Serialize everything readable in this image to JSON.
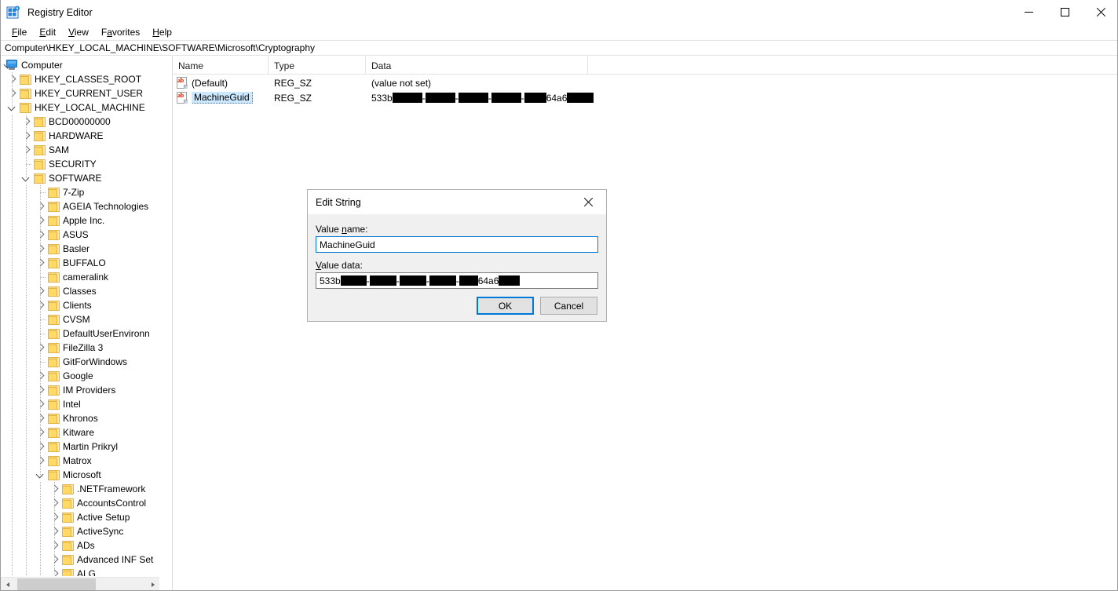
{
  "window": {
    "title": "Registry Editor",
    "icon": "registry-editor-icon",
    "controls": {
      "minimize": "minimize",
      "maximize": "maximize",
      "close": "close"
    }
  },
  "menubar": {
    "items": [
      {
        "label": "File",
        "mnemonic": "F"
      },
      {
        "label": "Edit",
        "mnemonic": "E"
      },
      {
        "label": "View",
        "mnemonic": "V"
      },
      {
        "label": "Favorites",
        "mnemonic": "a"
      },
      {
        "label": "Help",
        "mnemonic": "H"
      }
    ]
  },
  "address": {
    "path": "Computer\\HKEY_LOCAL_MACHINE\\SOFTWARE\\Microsoft\\Cryptography"
  },
  "tree": {
    "items": [
      {
        "label": "Computer",
        "depth": 0,
        "state": "expanded",
        "icon": "computer-icon"
      },
      {
        "label": "HKEY_CLASSES_ROOT",
        "depth": 1,
        "state": "collapsed",
        "icon": "folder-icon"
      },
      {
        "label": "HKEY_CURRENT_USER",
        "depth": 1,
        "state": "collapsed",
        "icon": "folder-icon"
      },
      {
        "label": "HKEY_LOCAL_MACHINE",
        "depth": 1,
        "state": "expanded",
        "icon": "folder-icon"
      },
      {
        "label": "BCD00000000",
        "depth": 2,
        "state": "collapsed",
        "icon": "folder-icon"
      },
      {
        "label": "HARDWARE",
        "depth": 2,
        "state": "collapsed",
        "icon": "folder-icon"
      },
      {
        "label": "SAM",
        "depth": 2,
        "state": "collapsed",
        "icon": "folder-icon"
      },
      {
        "label": "SECURITY",
        "depth": 2,
        "state": "leaf",
        "icon": "folder-icon"
      },
      {
        "label": "SOFTWARE",
        "depth": 2,
        "state": "expanded",
        "icon": "folder-icon"
      },
      {
        "label": "7-Zip",
        "depth": 3,
        "state": "leaf",
        "icon": "folder-icon"
      },
      {
        "label": "AGEIA Technologies",
        "depth": 3,
        "state": "collapsed",
        "icon": "folder-icon"
      },
      {
        "label": "Apple Inc.",
        "depth": 3,
        "state": "collapsed",
        "icon": "folder-icon"
      },
      {
        "label": "ASUS",
        "depth": 3,
        "state": "collapsed",
        "icon": "folder-icon"
      },
      {
        "label": "Basler",
        "depth": 3,
        "state": "collapsed",
        "icon": "folder-icon"
      },
      {
        "label": "BUFFALO",
        "depth": 3,
        "state": "collapsed",
        "icon": "folder-icon"
      },
      {
        "label": "cameralink",
        "depth": 3,
        "state": "leaf",
        "icon": "folder-icon"
      },
      {
        "label": "Classes",
        "depth": 3,
        "state": "collapsed",
        "icon": "folder-icon"
      },
      {
        "label": "Clients",
        "depth": 3,
        "state": "collapsed",
        "icon": "folder-icon"
      },
      {
        "label": "CVSM",
        "depth": 3,
        "state": "leaf",
        "icon": "folder-icon"
      },
      {
        "label": "DefaultUserEnvironn",
        "depth": 3,
        "state": "leaf",
        "icon": "folder-icon"
      },
      {
        "label": "FileZilla 3",
        "depth": 3,
        "state": "collapsed",
        "icon": "folder-icon"
      },
      {
        "label": "GitForWindows",
        "depth": 3,
        "state": "leaf",
        "icon": "folder-icon"
      },
      {
        "label": "Google",
        "depth": 3,
        "state": "collapsed",
        "icon": "folder-icon"
      },
      {
        "label": "IM Providers",
        "depth": 3,
        "state": "collapsed",
        "icon": "folder-icon"
      },
      {
        "label": "Intel",
        "depth": 3,
        "state": "collapsed",
        "icon": "folder-icon"
      },
      {
        "label": "Khronos",
        "depth": 3,
        "state": "collapsed",
        "icon": "folder-icon"
      },
      {
        "label": "Kitware",
        "depth": 3,
        "state": "collapsed",
        "icon": "folder-icon"
      },
      {
        "label": "Martin Prikryl",
        "depth": 3,
        "state": "collapsed",
        "icon": "folder-icon"
      },
      {
        "label": "Matrox",
        "depth": 3,
        "state": "collapsed",
        "icon": "folder-icon"
      },
      {
        "label": "Microsoft",
        "depth": 3,
        "state": "expanded",
        "icon": "folder-icon"
      },
      {
        "label": ".NETFramework",
        "depth": 4,
        "state": "collapsed",
        "icon": "folder-icon"
      },
      {
        "label": "AccountsControl",
        "depth": 4,
        "state": "collapsed",
        "icon": "folder-icon"
      },
      {
        "label": "Active Setup",
        "depth": 4,
        "state": "collapsed",
        "icon": "folder-icon"
      },
      {
        "label": "ActiveSync",
        "depth": 4,
        "state": "collapsed",
        "icon": "folder-icon"
      },
      {
        "label": "ADs",
        "depth": 4,
        "state": "collapsed",
        "icon": "folder-icon"
      },
      {
        "label": "Advanced INF Set",
        "depth": 4,
        "state": "collapsed",
        "icon": "folder-icon"
      },
      {
        "label": "ALG",
        "depth": 4,
        "state": "collapsed",
        "icon": "folder-icon"
      }
    ]
  },
  "list": {
    "columns": [
      {
        "label": "Name"
      },
      {
        "label": "Type"
      },
      {
        "label": "Data"
      }
    ],
    "rows": [
      {
        "name": "(Default)",
        "type": "REG_SZ",
        "data_prefix": "(value not set)",
        "data_suffix": "",
        "selected": false,
        "icon": "string-value-icon"
      },
      {
        "name": "MachineGuid",
        "type": "REG_SZ",
        "data_prefix": "533b",
        "data_middle": "64a6",
        "data_suffix": "",
        "selected": true,
        "icon": "string-value-icon",
        "redacted": true
      }
    ]
  },
  "dialog": {
    "title": "Edit String",
    "close_label": "close",
    "value_name_label": "Value name:",
    "value_name_mnemonic": "n",
    "value_name": "MachineGuid",
    "value_data_label": "Value data:",
    "value_data_mnemonic": "V",
    "value_data_prefix": "533b",
    "value_data_middle": "64a6",
    "ok_label": "OK",
    "cancel_label": "Cancel"
  },
  "colors": {
    "accent": "#0078d7",
    "selection": "#cce8ff",
    "folder": "#ffd966",
    "redaction": "#000000",
    "window_bg": "#ffffff",
    "dialog_bg": "#f0f0f0"
  }
}
